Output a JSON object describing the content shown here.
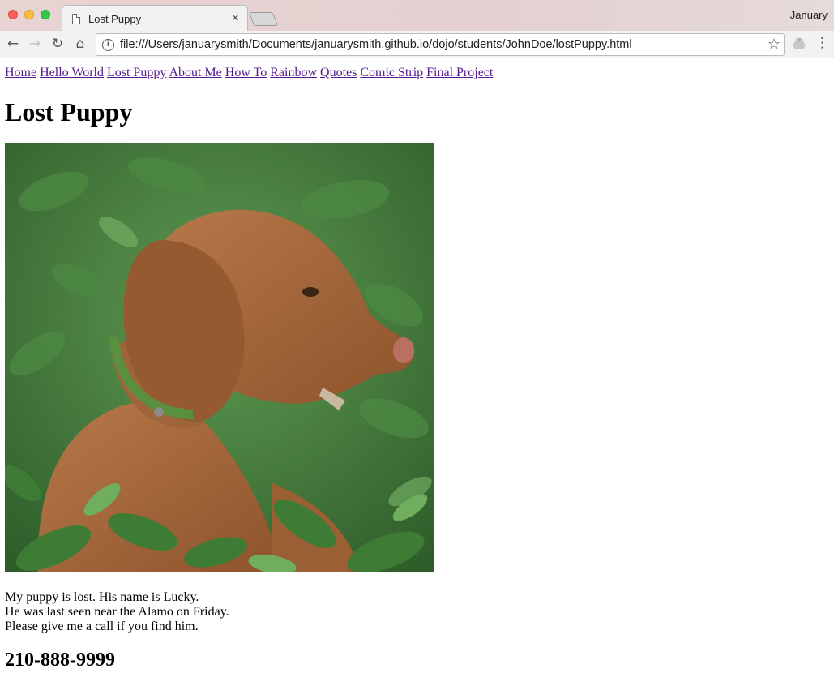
{
  "browser": {
    "tab_title": "Lost Puppy",
    "tab_close": "×",
    "profile_name": "January",
    "url": "file:///Users/januarysmith/Documents/januarysmith.github.io/dojo/students/JohnDoe/lostPuppy.html",
    "icons": {
      "back": "←",
      "forward": "→",
      "reload": "↻",
      "home": "⌂",
      "info": "i",
      "star": "☆",
      "menu": "⋮"
    }
  },
  "nav": {
    "links": [
      {
        "label": "Home"
      },
      {
        "label": "Hello World"
      },
      {
        "label": "Lost Puppy"
      },
      {
        "label": "About Me"
      },
      {
        "label": "How To"
      },
      {
        "label": "Rainbow"
      },
      {
        "label": "Quotes"
      },
      {
        "label": "Comic Strip"
      },
      {
        "label": "Final Project"
      }
    ]
  },
  "page": {
    "title": "Lost Puppy",
    "description_lines": [
      "My puppy is lost. His name is Lucky.",
      "He was last seen near the Alamo on Friday.",
      "Please give me a call if you find him."
    ],
    "phone": "210-888-9999"
  },
  "colors": {
    "link_visited": "#551a8b",
    "foliage": "#3f7a35",
    "dog": "#a86a3c"
  }
}
